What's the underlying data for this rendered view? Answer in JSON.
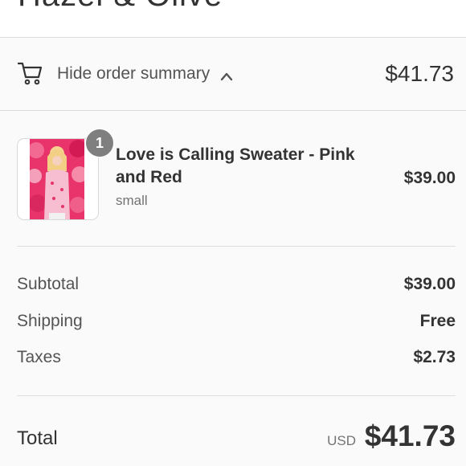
{
  "header": {
    "store_name": "Hazel & Olive"
  },
  "summary_toggle": {
    "label": "Hide order summary",
    "total": "$41.73",
    "cart_icon": "cart-icon",
    "chevron_icon": "chevron-up-icon"
  },
  "product": {
    "quantity": "1",
    "name": "Love is Calling Sweater - Pink and Red",
    "variant": "small",
    "price": "$39.00"
  },
  "costs": {
    "subtotal_label": "Subtotal",
    "subtotal_value": "$39.00",
    "shipping_label": "Shipping",
    "shipping_value": "Free",
    "taxes_label": "Taxes",
    "taxes_value": "$2.73"
  },
  "total": {
    "label": "Total",
    "currency": "USD",
    "value": "$41.73"
  },
  "colors": {
    "background": "#fafafa",
    "text": "#333333",
    "muted": "#737373",
    "badge": "#7f7f7f",
    "border": "#dedede"
  }
}
